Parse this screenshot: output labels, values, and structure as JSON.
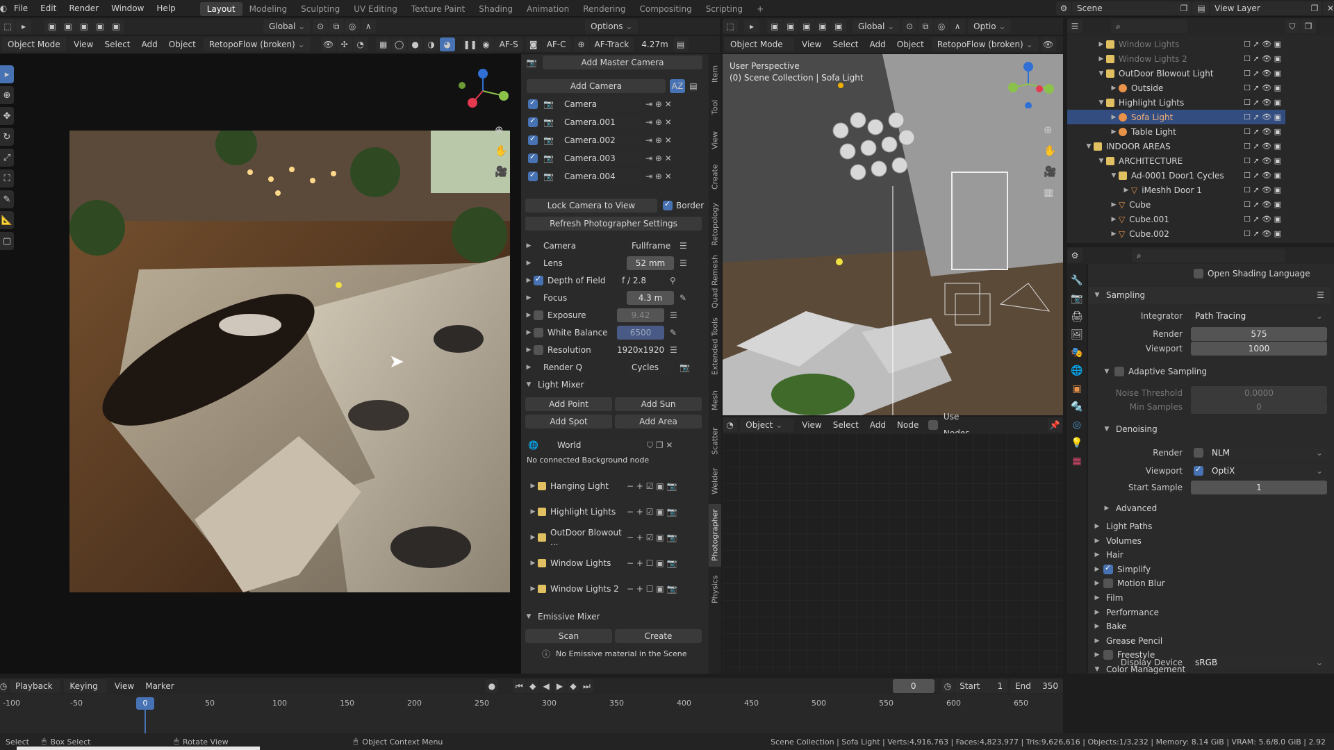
{
  "topmenu": {
    "items": [
      "File",
      "Edit",
      "Render",
      "Window",
      "Help"
    ],
    "workspaces": [
      "Layout",
      "Modeling",
      "Sculpting",
      "UV Editing",
      "Texture Paint",
      "Shading",
      "Animation",
      "Rendering",
      "Compositing",
      "Scripting",
      "+"
    ],
    "scene": "Scene",
    "view_layer": "View Layer"
  },
  "viewport_left": {
    "transform": "Global",
    "options": "Options",
    "mode": "Object Mode",
    "menus": [
      "View",
      "Select",
      "Add",
      "Object"
    ],
    "retopo": "RetopoFlow (broken)",
    "af_s": "AF-S",
    "af_c": "AF-C",
    "af_track": "AF-Track",
    "distance": "4.27m"
  },
  "photographer": {
    "add_master_camera": "Add Master Camera",
    "add_camera": "Add Camera",
    "cameras": [
      "Camera",
      "Camera.001",
      "Camera.002",
      "Camera.003",
      "Camera.004"
    ],
    "lock_camera": "Lock Camera to View",
    "border": "Border",
    "refresh": "Refresh Photographer Settings",
    "settings": [
      {
        "label": "Camera",
        "value": "Fullframe"
      },
      {
        "label": "Lens",
        "value": "52 mm"
      },
      {
        "label": "Depth of Field",
        "value": "f / 2.8"
      },
      {
        "label": "Focus",
        "value": "4.3 m"
      },
      {
        "label": "Exposure",
        "value": "9.42"
      },
      {
        "label": "White Balance",
        "value": "6500"
      },
      {
        "label": "Resolution",
        "value": "1920x1920"
      },
      {
        "label": "Render Q",
        "value": "Cycles"
      }
    ],
    "light_mixer": "Light Mixer",
    "add_point": "Add Point",
    "add_sun": "Add Sun",
    "add_spot": "Add Spot",
    "add_area": "Add Area",
    "world": "World",
    "no_bg": "No connected Background node",
    "light_groups": [
      "Hanging Light",
      "Highlight Lights",
      "OutDoor Blowout ...",
      "Window Lights",
      "Window Lights 2"
    ],
    "emissive_mixer": "Emissive Mixer",
    "scan": "Scan",
    "create": "Create",
    "no_emissive": "No Emissive material in the Scene"
  },
  "side_tabs": [
    "Item",
    "Tool",
    "View",
    "Create",
    "Retopology",
    "Quad Remesh",
    "Extended Tools",
    "Mesh",
    "Scatter",
    "Welder",
    "Photographer",
    "Physics"
  ],
  "viewport_right": {
    "mode": "Object Mode",
    "menus": [
      "View",
      "Select",
      "Add",
      "Object"
    ],
    "retopo": "RetopoFlow (broken)",
    "transform": "Global",
    "options": "Optio",
    "perspective": "User Perspective",
    "collection": "(0) Scene Collection | Sofa Light"
  },
  "node_editor": {
    "object": "Object",
    "menus": [
      "View",
      "Select",
      "Add",
      "Node"
    ],
    "use_nodes": "Use Nodes"
  },
  "outliner": {
    "rows": [
      {
        "label": "Window Lights",
        "kind": "collection",
        "indent": 0,
        "dim": true
      },
      {
        "label": "Window Lights 2",
        "kind": "collection",
        "indent": 0,
        "dim": true
      },
      {
        "label": "OutDoor Blowout Light",
        "kind": "collection",
        "indent": 0
      },
      {
        "label": "Outside",
        "kind": "light",
        "indent": 1
      },
      {
        "label": "Highlight Lights",
        "kind": "collection",
        "indent": 0
      },
      {
        "label": "Sofa Light",
        "kind": "light",
        "indent": 1,
        "selected": true
      },
      {
        "label": "Table Light",
        "kind": "light",
        "indent": 1
      },
      {
        "label": "INDOOR AREAS",
        "kind": "collection",
        "indent": -1
      },
      {
        "label": "ARCHITECTURE",
        "kind": "collection",
        "indent": 0
      },
      {
        "label": "Ad-0001 Door1 Cycles",
        "kind": "collection",
        "indent": 1
      },
      {
        "label": "iMeshh Door 1",
        "kind": "mesh",
        "indent": 2
      },
      {
        "label": "Cube",
        "kind": "mesh",
        "indent": 1
      },
      {
        "label": "Cube.001",
        "kind": "mesh",
        "indent": 1
      },
      {
        "label": "Cube.002",
        "kind": "mesh",
        "indent": 1
      }
    ]
  },
  "properties": {
    "open_shading_language": "Open Shading Language",
    "sampling": "Sampling",
    "integrator_label": "Integrator",
    "integrator": "Path Tracing",
    "render_label": "Render",
    "render_samples": "575",
    "viewport_label": "Viewport",
    "viewport_samples": "1000",
    "adaptive_sampling": "Adaptive Sampling",
    "noise_threshold_label": "Noise Threshold",
    "noise_threshold": "0.0000",
    "min_samples_label": "Min Samples",
    "min_samples": "0",
    "denoising": "Denoising",
    "denoise_render": "NLM",
    "denoise_viewport": "OptiX",
    "start_sample_label": "Start Sample",
    "start_sample": "1",
    "advanced": "Advanced",
    "sections": [
      "Light Paths",
      "Volumes",
      "Hair",
      "Simplify",
      "Motion Blur",
      "Film",
      "Performance",
      "Bake",
      "Grease Pencil",
      "Freestyle",
      "Color Management"
    ],
    "display_device_label": "Display Device",
    "display_device": "sRGB"
  },
  "timeline": {
    "menus": [
      "Playback",
      "Keying",
      "View",
      "Marker"
    ],
    "current_frame": "0",
    "start_label": "Start",
    "start": "1",
    "end_label": "End",
    "end": "350",
    "ticks": [
      "-100",
      "-50",
      "0",
      "50",
      "100",
      "150",
      "200",
      "250",
      "300",
      "350",
      "400",
      "450",
      "500",
      "550",
      "600",
      "650"
    ]
  },
  "statusbar": {
    "select": "Select",
    "box_select": "Box Select",
    "rotate_view": "Rotate View",
    "context_menu": "Object Context Menu",
    "stats": "Scene Collection | Sofa Light | Verts:4,916,763 | Faces:4,823,977 | Tris:9,626,616 | Objects:1/3,232 | Memory: 8.14 GiB | VRAM: 5.6/8.0 GiB | 2.92"
  }
}
